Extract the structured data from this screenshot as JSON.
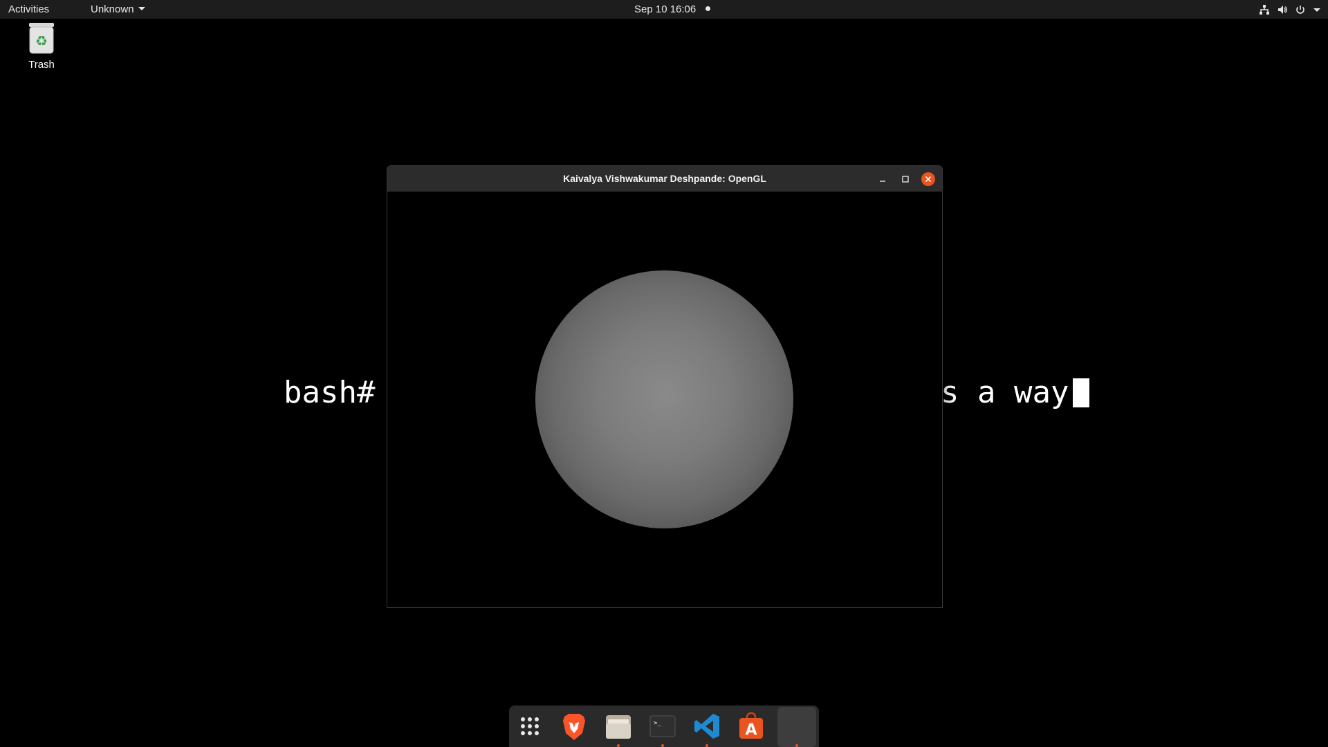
{
  "topbar": {
    "activities": "Activities",
    "app_menu": "Unknown",
    "clock": "Sep 10  16:06"
  },
  "desktop": {
    "trash_label": "Trash"
  },
  "terminal": {
    "left_text": "bash#",
    "right_text": "s a way"
  },
  "window": {
    "title": "Kaivalya Vishwakumar Deshpande: OpenGL"
  },
  "dock": {
    "items": [
      "show-applications",
      "brave-browser",
      "files",
      "terminal",
      "visual-studio-code",
      "ubuntu-software",
      "opengl-app"
    ]
  },
  "colors": {
    "accent": "#e95420",
    "topbar": "#1d1d1d",
    "titlebar": "#2c2c2c",
    "dock": "#2a2a2a"
  }
}
